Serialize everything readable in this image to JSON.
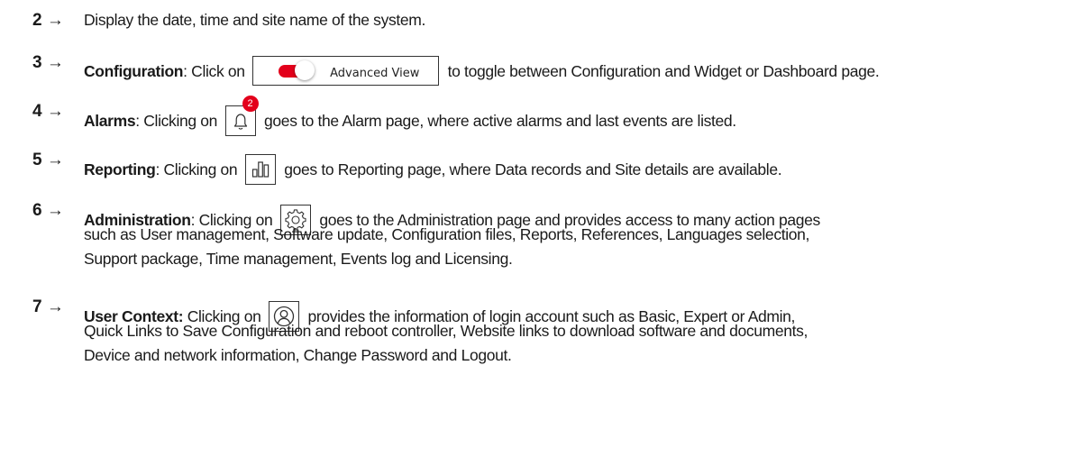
{
  "items": [
    {
      "number": "2",
      "arrow": "→",
      "text": "Display the date, time and site name of the system."
    },
    {
      "number": "3",
      "arrow": "→",
      "title": "Configuration",
      "before": ": Click on ",
      "after": " to toggle between Configuration and Widget or Dashboard page.",
      "toggle_label": "Advanced View",
      "toggle_color": "#e3001b"
    },
    {
      "number": "4",
      "arrow": "→",
      "title": "Alarms",
      "before": ": Clicking on ",
      "after": " goes to the Alarm page, where active alarms and last events are listed.",
      "icon": "bell-icon",
      "badge": "2"
    },
    {
      "number": "5",
      "arrow": "→",
      "title": "Reporting",
      "before": ": Clicking on ",
      "after": " goes to Reporting page, where Data records and Site details are available.",
      "icon": "bar-chart-icon"
    },
    {
      "number": "6",
      "arrow": "→",
      "title": "Administration",
      "before": ": Clicking on ",
      "after": " goes to the Administration page and provides access to many action pages",
      "line2": "such as User management, Software update, Configuration files, Reports, References, Languages selection,",
      "line3": "Support package, Time management, Events log and Licensing.",
      "icon": "gear-icon"
    },
    {
      "number": "7",
      "arrow": "→",
      "title": "User Context:",
      "before": " Clicking on ",
      "after": " provides the information of login account such as Basic, Expert or Admin,",
      "line2": "Quick Links to Save Configuration and reboot controller, Website links to download software and documents,",
      "line3": "Device and network information, Change Password and Logout.",
      "icon": "user-icon"
    }
  ]
}
